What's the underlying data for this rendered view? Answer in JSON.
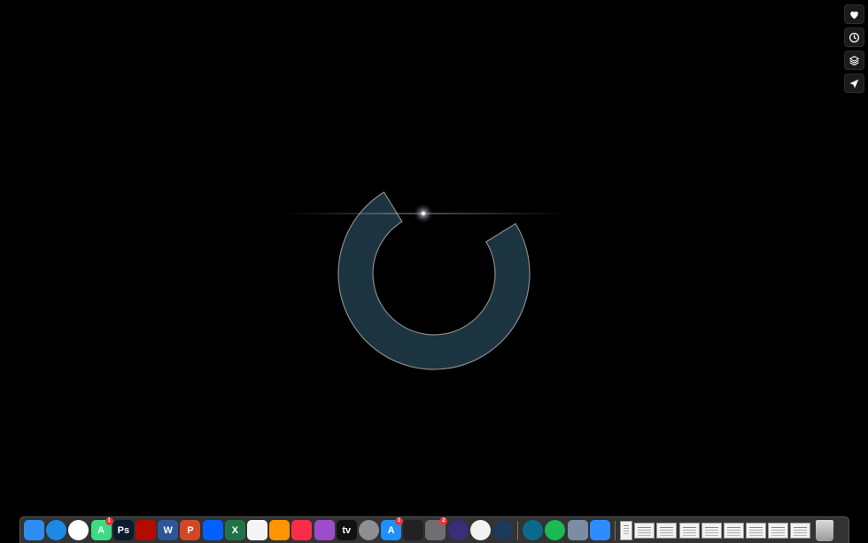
{
  "side_actions": [
    {
      "name": "heart-icon"
    },
    {
      "name": "clock-icon"
    },
    {
      "name": "layers-icon"
    },
    {
      "name": "send-icon"
    }
  ],
  "loader": {
    "progress": 0.75,
    "ring_color": "#1c3340",
    "outline_color": "#8a8a8a",
    "background": "#000000"
  },
  "dock": {
    "apps": [
      {
        "name": "finder-icon",
        "label": "",
        "bg": "#2f8cf0"
      },
      {
        "name": "safari-icon",
        "label": "",
        "bg": "#1e88e5",
        "round": true
      },
      {
        "name": "chrome-icon",
        "label": "",
        "bg": "#ffffff",
        "round": true
      },
      {
        "name": "android-icon",
        "label": "A",
        "bg": "#3ddc84",
        "badge": "1"
      },
      {
        "name": "photoshop-icon",
        "label": "Ps",
        "bg": "#0a1c2e"
      },
      {
        "name": "acrobat-icon",
        "label": "",
        "bg": "#b30b00"
      },
      {
        "name": "word-icon",
        "label": "W",
        "bg": "#2b579a"
      },
      {
        "name": "powerpoint-icon",
        "label": "P",
        "bg": "#d24726"
      },
      {
        "name": "dropbox-icon",
        "label": "",
        "bg": "#0061fe"
      },
      {
        "name": "excel-icon",
        "label": "X",
        "bg": "#217346"
      },
      {
        "name": "news-icon",
        "label": "",
        "bg": "#f5f5f5"
      },
      {
        "name": "books-icon",
        "label": "",
        "bg": "#ff9500"
      },
      {
        "name": "music-icon",
        "label": "",
        "bg": "#fa2d48"
      },
      {
        "name": "podcasts-icon",
        "label": "",
        "bg": "#9b4dca"
      },
      {
        "name": "apple-tv-icon",
        "label": "tv",
        "bg": "#111111"
      },
      {
        "name": "launchpad-icon",
        "label": "",
        "bg": "#8e8e93",
        "round": true
      },
      {
        "name": "app-store-icon",
        "label": "A",
        "bg": "#1e90ff",
        "badge": "1"
      },
      {
        "name": "final-cut-icon",
        "label": "",
        "bg": "#222222"
      },
      {
        "name": "system-preferences-icon",
        "label": "",
        "bg": "#6e6e73",
        "badge": "2"
      },
      {
        "name": "siri-icon",
        "label": "",
        "bg": "#3a2d7a",
        "round": true
      },
      {
        "name": "network-radar-icon",
        "label": "",
        "bg": "#f2f2f2",
        "round": true
      },
      {
        "name": "quicktime-icon",
        "label": "",
        "bg": "#1b3a5c",
        "round": true
      }
    ],
    "recent_apps": [
      {
        "name": "screen-saver-icon",
        "label": "",
        "bg": "#0b6a8c",
        "round": true
      },
      {
        "name": "spotify-icon",
        "label": "",
        "bg": "#1db954",
        "round": true
      },
      {
        "name": "preview-icon",
        "label": "",
        "bg": "#7a8da3"
      },
      {
        "name": "zoom-icon",
        "label": "",
        "bg": "#2d8cff"
      }
    ],
    "documents": [
      {
        "name": "document-thumbnail",
        "tall": true
      },
      {
        "name": "document-thumbnail"
      },
      {
        "name": "document-thumbnail"
      },
      {
        "name": "document-thumbnail"
      },
      {
        "name": "document-thumbnail"
      },
      {
        "name": "document-thumbnail"
      },
      {
        "name": "document-thumbnail"
      },
      {
        "name": "document-thumbnail"
      },
      {
        "name": "document-thumbnail"
      }
    ],
    "trash": {
      "name": "trash-icon"
    }
  }
}
